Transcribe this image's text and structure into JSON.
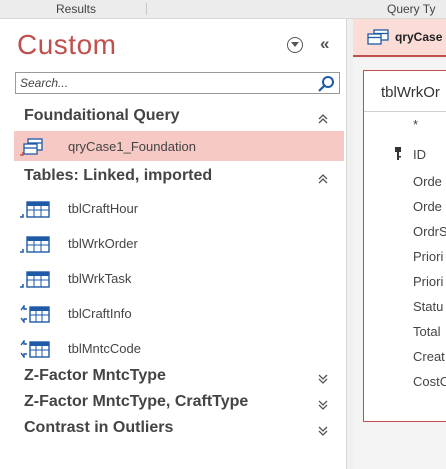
{
  "ribbon": {
    "results_label": "Results",
    "query_type_label": "Query Ty"
  },
  "nav": {
    "title": "Custom",
    "search_placeholder": "Search...",
    "groups": [
      {
        "label": "Foundaitional Query",
        "state": "expanded"
      },
      {
        "label": "Tables: Linked, imported",
        "state": "expanded"
      },
      {
        "label": "Z-Factor MntcType",
        "state": "collapsed"
      },
      {
        "label": "Z-Factor MntcType, CraftType",
        "state": "collapsed"
      },
      {
        "label": "Contrast in Outliers",
        "state": "collapsed"
      }
    ],
    "items": [
      {
        "label": "qryCase1_Foundation",
        "icon": "query-icon",
        "selected": true
      },
      {
        "label": "tblCraftHour",
        "icon": "table-icon"
      },
      {
        "label": "tblWrkOrder",
        "icon": "table-icon"
      },
      {
        "label": "tblWrkTask",
        "icon": "table-icon"
      },
      {
        "label": "tblCraftInfo",
        "icon": "linked-table-icon"
      },
      {
        "label": "tblMntcCode",
        "icon": "linked-table-icon"
      }
    ]
  },
  "document": {
    "tab_label": "qryCase",
    "table_name": "tblWrkOr",
    "fields": [
      "*",
      "ID",
      "Orde",
      "Orde",
      "OrdrS",
      "Priori",
      "Priori",
      "Statu",
      "Total",
      "Creat",
      "CostC"
    ]
  },
  "colors": {
    "accent": "#c0504d",
    "selected_bg": "#f6c9c4"
  }
}
